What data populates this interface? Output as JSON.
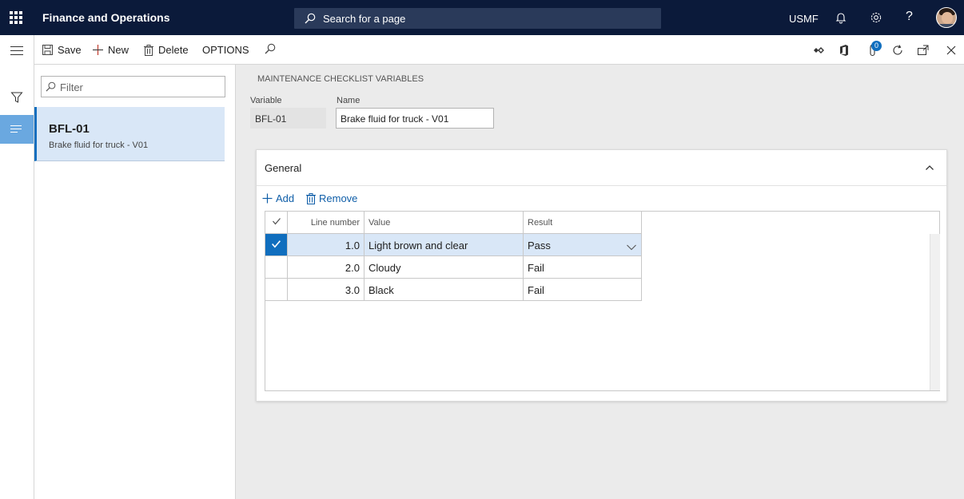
{
  "app": {
    "title": "Finance and Operations",
    "search_placeholder": "Search for a page",
    "company": "USMF",
    "badge_count": "0"
  },
  "toolbar": {
    "save": "Save",
    "new": "New",
    "delete": "Delete",
    "options": "OPTIONS"
  },
  "list": {
    "filter_placeholder": "Filter",
    "items": [
      {
        "id": "BFL-01",
        "name": "Brake fluid for truck - V01"
      }
    ]
  },
  "form": {
    "caption": "MAINTENANCE CHECKLIST VARIABLES",
    "variable_label": "Variable",
    "variable_value": "BFL-01",
    "name_label": "Name",
    "name_value": "Brake fluid for truck - V01"
  },
  "general": {
    "title": "General",
    "add": "Add",
    "remove": "Remove",
    "columns": [
      "Line number",
      "Value",
      "Result"
    ],
    "rows": [
      {
        "line": "1.0",
        "value": "Light brown and clear",
        "result": "Pass",
        "selected": true
      },
      {
        "line": "2.0",
        "value": "Cloudy",
        "result": "Fail",
        "selected": false
      },
      {
        "line": "3.0",
        "value": "Black",
        "result": "Fail",
        "selected": false
      }
    ]
  },
  "colors": {
    "topbar": "#0b1a3a",
    "accent": "#106ebe",
    "selection": "#d9e7f7",
    "rail_active": "#6aa8e0"
  }
}
